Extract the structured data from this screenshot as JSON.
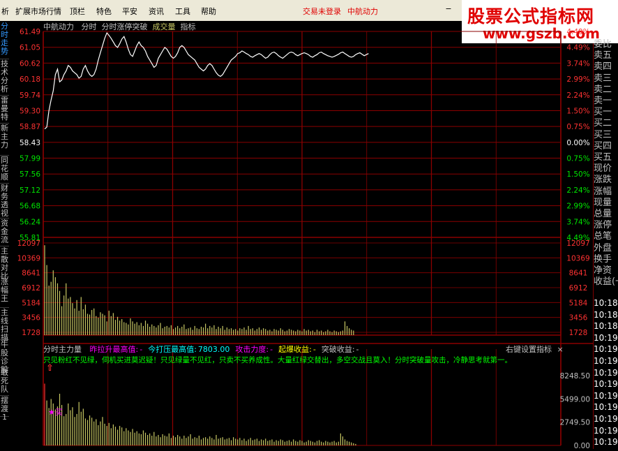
{
  "menubar": {
    "items": [
      "析",
      "扩展市场行情",
      "顶栏",
      "特色",
      "平安",
      "资讯",
      "工具",
      "帮助"
    ],
    "trade_status": "交易未登录",
    "stock_name": "中航动力"
  },
  "watermark": {
    "title": "股票公式指标网",
    "url": "www.gszb.com"
  },
  "left_tabs": [
    "分时走势",
    "技术分析",
    "雷曼特",
    "新主力",
    "同花顺",
    "财务透视",
    "资金流",
    "主散对比",
    "涨幅王",
    "主线扫描",
    "牛股诊股",
    "敢死队",
    "摆渡1"
  ],
  "price_header": {
    "name": "中航动力",
    "mode": "分时",
    "indicator": "分时涨停突破",
    "vol_label": "成交量",
    "ind_label": "指标"
  },
  "price_axis": {
    "prices": [
      "61.49",
      "61.05",
      "60.62",
      "60.18",
      "59.74",
      "59.30",
      "58.87",
      "58.43",
      "57.99",
      "57.56",
      "57.12",
      "56.68",
      "56.24",
      "55.81"
    ],
    "percents": [
      "4.49%",
      "4.49%",
      "3.74%",
      "2.99%",
      "2.24%",
      "1.50%",
      "0.75%",
      "0.00%",
      "0.75%",
      "1.50%",
      "2.24%",
      "2.99%",
      "3.74%",
      "4.49%"
    ]
  },
  "volume_axis": [
    "12097",
    "10369",
    "8641",
    "6912",
    "5184",
    "3456",
    "1728"
  ],
  "chart_data": {
    "type": "line",
    "title": "中航动力 分时",
    "x_unit": "minutes since open",
    "price_series": {
      "name": "分时",
      "x": [
        0,
        1,
        2,
        3,
        4,
        5,
        6,
        7,
        8,
        9,
        10,
        11,
        12,
        13,
        14,
        15,
        16,
        17,
        18,
        19,
        20,
        21,
        22,
        23,
        24,
        25,
        26,
        27,
        28,
        29,
        30,
        31,
        32,
        33,
        34,
        35,
        36,
        37,
        38,
        39,
        40,
        41,
        42,
        43,
        44,
        45,
        46,
        47,
        48,
        49,
        50,
        51,
        52,
        53,
        54,
        55,
        56,
        57,
        58,
        59,
        60,
        61,
        62,
        63,
        64,
        65,
        66,
        67,
        68,
        69,
        70,
        71,
        72,
        73,
        74,
        75,
        76,
        77,
        78,
        79,
        80,
        81,
        82,
        83,
        84,
        85,
        86,
        87,
        88,
        89,
        90,
        91,
        92,
        93,
        94,
        95,
        96,
        97,
        98,
        99,
        100,
        101,
        102,
        103,
        104,
        105,
        106,
        107,
        108,
        109,
        110,
        111,
        112,
        113,
        114,
        115,
        116,
        117,
        118,
        119,
        120,
        121,
        122,
        123,
        124,
        125,
        126,
        127,
        128,
        129,
        130,
        131,
        132,
        133,
        134,
        135,
        136,
        137,
        138,
        139,
        140,
        141,
        142,
        143,
        144,
        145,
        146,
        147,
        148,
        149,
        150,
        151
      ],
      "y": [
        58.8,
        58.85,
        59.3,
        59.6,
        59.85,
        60.3,
        60.45,
        60.1,
        60.15,
        60.3,
        60.4,
        60.55,
        60.5,
        60.4,
        60.35,
        60.3,
        60.2,
        60.25,
        60.45,
        60.55,
        60.4,
        60.3,
        60.25,
        60.3,
        60.45,
        60.7,
        60.9,
        61.1,
        61.3,
        61.45,
        61.38,
        61.3,
        61.2,
        61.1,
        61.05,
        61.15,
        61.28,
        61.35,
        61.2,
        61.0,
        60.85,
        60.8,
        60.95,
        61.1,
        61.2,
        61.1,
        61.05,
        60.95,
        60.8,
        60.7,
        60.6,
        60.5,
        60.55,
        60.75,
        60.85,
        60.95,
        61.05,
        61.0,
        60.9,
        60.8,
        60.75,
        60.8,
        60.9,
        61.05,
        61.1,
        61.05,
        60.95,
        60.85,
        60.8,
        60.75,
        60.7,
        60.6,
        60.5,
        60.45,
        60.4,
        60.45,
        60.55,
        60.6,
        60.55,
        60.45,
        60.35,
        60.28,
        60.25,
        60.3,
        60.4,
        60.5,
        60.6,
        60.7,
        60.75,
        60.8,
        60.88,
        60.9,
        60.95,
        60.92,
        60.88,
        60.85,
        60.8,
        60.78,
        60.82,
        60.85,
        60.88,
        60.85,
        60.8,
        60.75,
        60.78,
        60.85,
        60.9,
        60.92,
        60.88,
        60.82,
        60.78,
        60.75,
        60.8,
        60.85,
        60.9,
        60.92,
        60.9,
        60.85,
        60.82,
        60.85,
        60.88,
        60.9,
        60.88,
        60.85,
        60.8,
        60.78,
        60.82,
        60.85,
        60.9,
        60.92,
        60.88,
        60.85,
        60.82,
        60.8,
        60.78,
        60.8,
        60.83,
        60.86,
        60.9,
        60.92,
        60.88,
        60.84,
        60.8,
        60.78,
        60.8,
        60.85,
        60.88,
        60.9,
        60.86,
        60.82,
        60.85,
        60.88
      ],
      "ylim": [
        55.81,
        61.49
      ],
      "base_price": 58.43
    },
    "volume_series": {
      "name": "成交量",
      "values": [
        11800,
        9200,
        6500,
        7000,
        8500,
        7600,
        6800,
        5800,
        3800,
        5200,
        6800,
        4800,
        5000,
        4200,
        3500,
        4600,
        3200,
        5000,
        3400,
        4000,
        2800,
        2700,
        3300,
        3500,
        2500,
        2300,
        3000,
        2800,
        2600,
        1800,
        3200,
        2500,
        2900,
        2000,
        2400,
        1900,
        2100,
        1700,
        1600,
        1400,
        2200,
        1800,
        1500,
        1700,
        1300,
        1600,
        1200,
        1900,
        1500,
        1100,
        1400,
        1200,
        1000,
        1300,
        1600,
        900,
        1100,
        1200,
        1000,
        1300,
        800,
        1000,
        1200,
        900,
        1100,
        1400,
        800,
        900,
        1000,
        700,
        1200,
        900,
        800,
        1100,
        1000,
        1500,
        900,
        1200,
        1000,
        1300,
        800,
        1100,
        900,
        1200,
        700,
        1000,
        800,
        900,
        700,
        800,
        600,
        900,
        800,
        1000,
        700,
        1200,
        800,
        900,
        600,
        800,
        1000,
        700,
        900,
        800,
        600,
        700,
        500,
        800,
        700,
        600,
        900,
        700,
        500,
        600,
        800,
        700,
        600,
        500,
        700,
        600,
        500,
        800,
        600,
        700,
        500,
        600,
        400,
        700,
        500,
        600,
        400,
        500,
        700,
        500,
        400,
        600,
        500,
        400,
        500,
        600,
        1800,
        1200,
        900,
        700,
        600
      ],
      "ylim": [
        0,
        12097
      ]
    },
    "indicator_series": {
      "name": "分时主力量",
      "values": [
        8248.5,
        6000,
        5000,
        6200,
        5600,
        4800,
        5200,
        6900,
        5400,
        3900,
        4200,
        5600,
        4700,
        5100,
        3800,
        4200,
        5800,
        4500,
        4900,
        3600,
        3400,
        4000,
        3700,
        3200,
        3500,
        2700,
        3200,
        3800,
        2900,
        2600,
        3000,
        2300,
        2800,
        2500,
        2100,
        2600,
        2400,
        1900,
        2300,
        2000,
        1800,
        2200,
        1700,
        1900,
        1600,
        1500,
        2000,
        1700,
        1400,
        1600,
        1300,
        1800,
        1200,
        1400,
        1100,
        1500,
        1300,
        1200,
        1600,
        1000,
        1300,
        1100,
        1400,
        1200,
        900,
        1300,
        1000,
        1200,
        1500,
        900,
        1100,
        1000,
        1300,
        800,
        1000,
        1100,
        900,
        1200,
        1000,
        800,
        1400,
        900,
        1000,
        1100,
        800,
        900,
        1000,
        700,
        1100,
        900,
        800,
        1000,
        700,
        900,
        600,
        800,
        1000,
        700,
        800,
        900,
        600,
        800,
        700,
        900,
        600,
        700,
        800,
        500,
        700,
        600,
        800,
        700,
        500,
        600,
        700,
        500,
        800,
        600,
        500,
        700,
        600,
        400,
        500,
        700,
        600,
        500,
        400,
        600,
        700,
        500,
        400,
        600,
        500,
        400,
        500,
        600,
        400,
        500,
        1600,
        1200,
        800,
        600,
        500,
        400,
        300,
        200
      ],
      "ylim": [
        0,
        11000
      ]
    }
  },
  "indicator_header": {
    "name": "分时主力量",
    "items": [
      {
        "label": "昨拉升最高值:",
        "value": "-",
        "color": "#ff00ff"
      },
      {
        "label": "今打压最高值:",
        "value": "7803.00",
        "color": "#00ffff"
      },
      {
        "label": "攻击力度:",
        "value": "-",
        "color": "#ff00ff"
      },
      {
        "label": "起爆收益:",
        "value": "-",
        "color": "#ffff00"
      },
      {
        "label": "突破收益:",
        "value": "-",
        "color": "#c0c0c0"
      }
    ],
    "settings": "右键设置指标",
    "close": "×"
  },
  "indicator_note": "只见粉红不见绿，伺机买进莫迟疑！只见绿量不见红，只卖不买养成性。大量红绿交替出，多空交战且莫入！分时突破量攻击，冷静思考就第一。",
  "indicator_axis": [
    "8248.50",
    "5499.00",
    "2749.50",
    "0.00"
  ],
  "signal_label": "★买",
  "right_panel": {
    "labels": [
      "委比",
      "卖五",
      "卖四",
      "卖三",
      "卖二",
      "卖一",
      "买一",
      "买二",
      "买三",
      "买四",
      "买五",
      "现价",
      "涨跌",
      "涨幅",
      "现量",
      "总量",
      "涨停",
      "总笔",
      "外盘",
      "换手",
      "净资",
      "收益(一"
    ],
    "times": [
      "10:18",
      "10:18",
      "10:18",
      "10:19",
      "10:19",
      "10:19",
      "10:19",
      "10:19",
      "10:19",
      "10:19",
      "10:19",
      "10:19",
      "10:19"
    ]
  },
  "colors": {
    "grid": "#8b0000",
    "up": "#ff3232",
    "down": "#00e600",
    "flat": "#ffffff",
    "line": "#ffffff",
    "vol": "#c8c864"
  }
}
